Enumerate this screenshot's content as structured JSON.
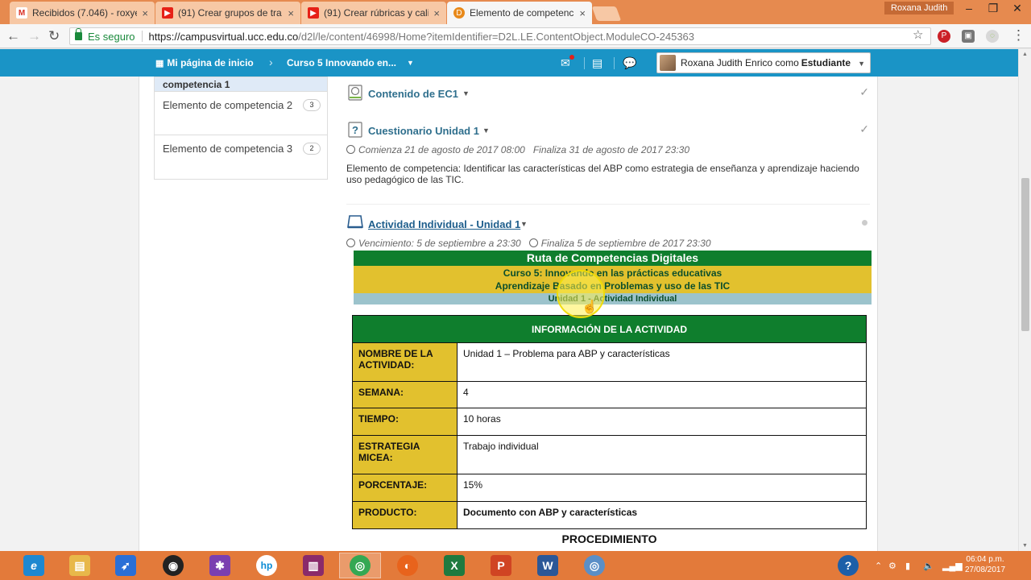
{
  "browser": {
    "tabs": [
      {
        "title": "Recibidos (7.046) - roxye",
        "icon": "gmail-icon",
        "icon_glyph": "M",
        "icon_color": "#d93025"
      },
      {
        "title": "(91) Crear grupos de tra",
        "icon": "youtube-icon",
        "icon_glyph": "▶",
        "icon_color": "#e62117"
      },
      {
        "title": "(91) Crear rúbricas y calif",
        "icon": "youtube-icon",
        "icon_glyph": "▶",
        "icon_color": "#e62117"
      },
      {
        "title": "Elemento de competenc",
        "icon": "d2l-icon",
        "icon_glyph": "D",
        "icon_color": "#e8891a"
      }
    ],
    "window_user": "Roxana Judith",
    "address": {
      "secure_label": "Es seguro",
      "url_host": "https://campusvirtual.ucc.edu.co",
      "url_path": "/d2l/le/content/46998/Home?itemIdentifier=D2L.LE.ContentObject.ModuleCO-245363"
    }
  },
  "navbar": {
    "home_label": "Mi página de inicio",
    "course_label": "Curso 5 Innovando en...",
    "user_label_prefix": "Roxana Judith Enrico como ",
    "user_role": "Estudiante"
  },
  "sidebar": {
    "selected_label": "competencia 1",
    "items": [
      {
        "label": "Elemento de competencia 2",
        "count": "3"
      },
      {
        "label": "Elemento de competencia 3",
        "count": "2"
      }
    ]
  },
  "content": {
    "item1_title": "Contenido de EC1",
    "item2_title": "Cuestionario Unidad 1",
    "item2_start": "Comienza 21 de agosto de 2017 08:00",
    "item2_end": "Finaliza 31 de agosto de 2017 23:30",
    "item2_desc": "Elemento de competencia: Identificar las características del ABP como estrategia de enseñanza y aprendizaje haciendo uso pedagógico de las TIC.",
    "item3_title": "Actividad Individual - Unidad 1",
    "item3_due": "Vencimiento: 5 de septiembre a 23:30",
    "item3_end": "Finaliza 5 de septiembre de 2017 23:30"
  },
  "banner": {
    "line1": "Ruta de Competencias Digitales",
    "line2": "Curso 5: Innovando en las prácticas educativas",
    "line3": "Aprendizaje Basado en Problemas y uso de las TIC",
    "line4": "Unidad 1 - Actividad Individual"
  },
  "info_table": {
    "header": "INFORMACIÓN DE LA ACTIVIDAD",
    "rows": [
      {
        "label": "NOMBRE DE LA ACTIVIDAD:",
        "value": "Unidad 1 – Problema para ABP y características"
      },
      {
        "label": "SEMANA:",
        "value": "4"
      },
      {
        "label": "TIEMPO:",
        "value": "10 horas"
      },
      {
        "label": "ESTRATEGIA MICEA:",
        "value": "Trabajo individual"
      },
      {
        "label": "PORCENTAJE:",
        "value": "15%"
      },
      {
        "label": "PRODUCTO:",
        "value": "Documento con ABP y características"
      }
    ],
    "procedure_title": "PROCEDIMIENTO"
  },
  "taskbar": {
    "time": "06:04 p.m.",
    "date": "27/08/2017",
    "apps": [
      {
        "icon": "ie-icon",
        "glyph": "e",
        "color": "#1e88d0"
      },
      {
        "icon": "file-explorer-icon",
        "glyph": "▤",
        "color": "#e8b84a"
      },
      {
        "icon": "rocket-app-icon",
        "glyph": "➶",
        "color": "#2a6fd6"
      },
      {
        "icon": "webcam-icon",
        "glyph": "◉",
        "color": "#222222"
      },
      {
        "icon": "puzzle-app-icon",
        "glyph": "✱",
        "color": "#7a3fb0"
      },
      {
        "icon": "hp-icon",
        "glyph": "hp",
        "color": "#0a8bd4"
      },
      {
        "icon": "winrar-icon",
        "glyph": "▥",
        "color": "#8a2a6a"
      },
      {
        "icon": "chrome-icon",
        "glyph": "◎",
        "color": "#34a853"
      },
      {
        "icon": "firefox-icon",
        "glyph": "◐",
        "color": "#e8631c"
      },
      {
        "icon": "excel-icon",
        "glyph": "X",
        "color": "#1f7a3f"
      },
      {
        "icon": "powerpoint-icon",
        "glyph": "P",
        "color": "#d04423"
      },
      {
        "icon": "word-icon",
        "glyph": "W",
        "color": "#2b5797"
      },
      {
        "icon": "recorder-icon",
        "glyph": "◎",
        "color": "#5b8fc7"
      }
    ]
  }
}
